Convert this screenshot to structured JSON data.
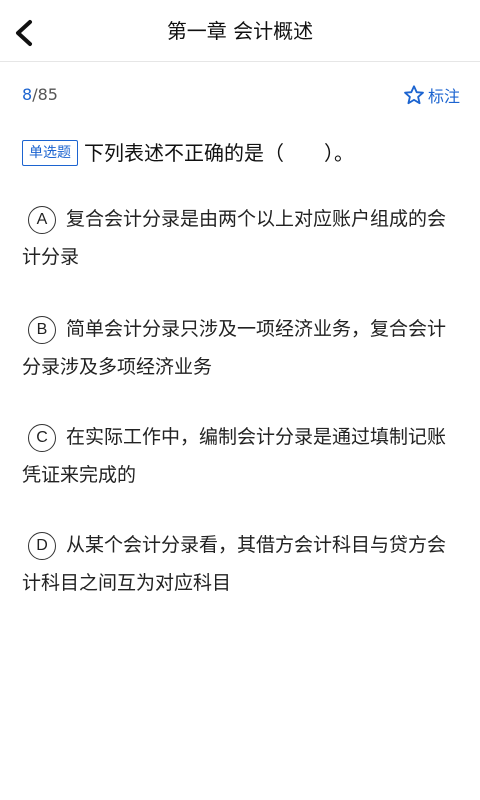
{
  "header": {
    "title": "第一章 会计概述"
  },
  "progress": {
    "current": "8",
    "separator": "/",
    "total": "85"
  },
  "mark": {
    "label": "标注",
    "icon": "star-outline-icon"
  },
  "question": {
    "type_label": "单选题",
    "text": "下列表述不正确的是（　　）。"
  },
  "options": [
    {
      "letter": "A",
      "text": "复合会计分录是由两个以上对应账户组成的会计分录"
    },
    {
      "letter": "B",
      "text": "简单会计分录只涉及一项经济业务，复合会计分录涉及多项经济业务"
    },
    {
      "letter": "C",
      "text": "在实际工作中，编制会计分录是通过填制记账凭证来完成的"
    },
    {
      "letter": "D",
      "text": "从某个会计分录看，其借方会计科目与贷方会计科目之间互为对应科目"
    }
  ],
  "colors": {
    "accent": "#1c64d0",
    "text": "#222222",
    "divider": "#e6e6e6"
  }
}
